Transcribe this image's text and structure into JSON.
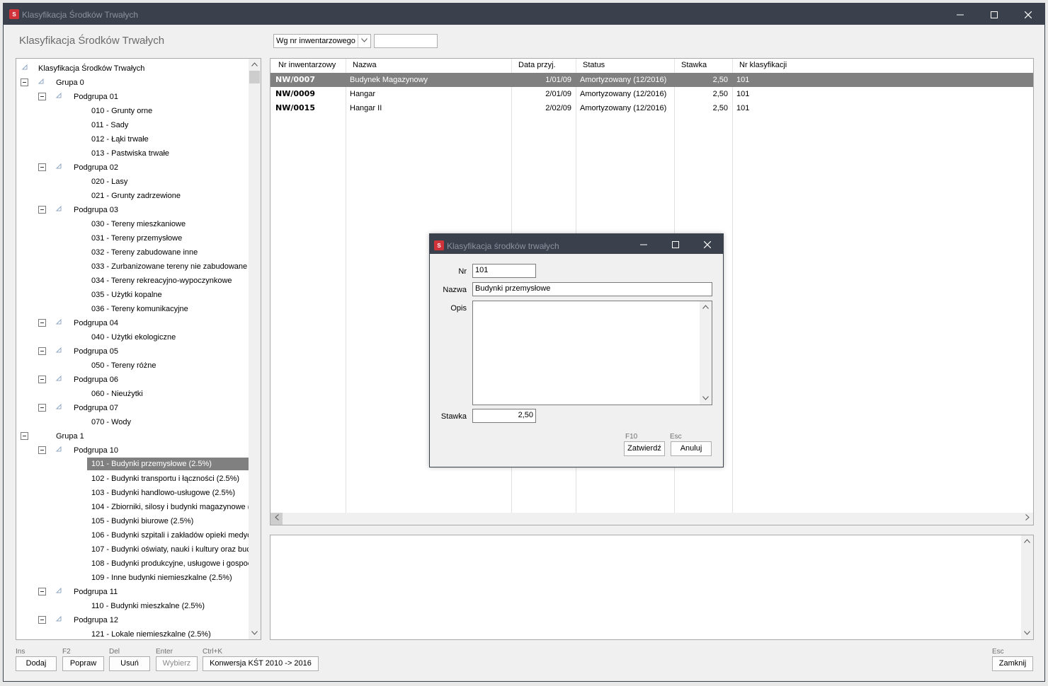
{
  "window": {
    "title": "Klasyfikacja Środków Trwałych",
    "app_icon": "S",
    "minimize": "",
    "maximize": "☐",
    "close": "✕"
  },
  "page": {
    "heading": "Klasyfikacja Środków Trwałych"
  },
  "search": {
    "sort_by": "Wg nr inwentarzowego",
    "query": ""
  },
  "tree": {
    "items": [
      {
        "label": "Klasyfikacja Środków Trwałych",
        "level": 0,
        "expander": false,
        "triangle": true
      },
      {
        "label": "Grupa 0",
        "level": 1,
        "expander": true,
        "triangle": true
      },
      {
        "label": "Podgrupa 01",
        "level": 2,
        "expander": true,
        "triangle": true
      },
      {
        "label": "010 - Grunty orne",
        "level": 3
      },
      {
        "label": "011 - Sady",
        "level": 3
      },
      {
        "label": "012 - Łąki trwałe",
        "level": 3
      },
      {
        "label": "013 - Pastwiska trwałe",
        "level": 3
      },
      {
        "label": "Podgrupa 02",
        "level": 2,
        "expander": true,
        "triangle": true
      },
      {
        "label": "020 - Lasy",
        "level": 3
      },
      {
        "label": "021 - Grunty zadrzewione",
        "level": 3
      },
      {
        "label": "Podgrupa 03",
        "level": 2,
        "expander": true,
        "triangle": true
      },
      {
        "label": "030 - Tereny mieszkaniowe",
        "level": 3
      },
      {
        "label": "031 - Tereny przemysłowe",
        "level": 3
      },
      {
        "label": "032 - Tereny zabudowane inne",
        "level": 3
      },
      {
        "label": "033 - Zurbanizowane tereny nie zabudowane",
        "level": 3
      },
      {
        "label": "034 - Tereny rekreacyjno-wypoczynkowe",
        "level": 3
      },
      {
        "label": "035 - Użytki kopalne",
        "level": 3
      },
      {
        "label": "036 - Tereny komunikacyjne",
        "level": 3
      },
      {
        "label": "Podgrupa 04",
        "level": 2,
        "expander": true,
        "triangle": true
      },
      {
        "label": "040 - Użytki ekologiczne",
        "level": 3
      },
      {
        "label": "Podgrupa 05",
        "level": 2,
        "expander": true,
        "triangle": true
      },
      {
        "label": "050 - Tereny różne",
        "level": 3
      },
      {
        "label": "Podgrupa 06",
        "level": 2,
        "expander": true,
        "triangle": true
      },
      {
        "label": "060 - Nieużytki",
        "level": 3
      },
      {
        "label": "Podgrupa 07",
        "level": 2,
        "expander": true,
        "triangle": true
      },
      {
        "label": "070 - Wody",
        "level": 3
      },
      {
        "label": "Grupa 1",
        "level": 1,
        "expander": true,
        "triangle": false
      },
      {
        "label": "Podgrupa 10",
        "level": 2,
        "expander": true,
        "triangle": true
      },
      {
        "label": "101 - Budynki przemysłowe (2.5%)",
        "level": 3,
        "selected": true
      },
      {
        "label": "102 - Budynki transportu i łączności (2.5%)",
        "level": 3
      },
      {
        "label": "103 - Budynki handlowo-usługowe (2.5%)",
        "level": 3
      },
      {
        "label": "104 - Zbiorniki, silosy i budynki magazynowe (",
        "level": 3
      },
      {
        "label": "105 - Budynki biurowe (2.5%)",
        "level": 3
      },
      {
        "label": "106 - Budynki szpitali i zakładów opieki medyc",
        "level": 3
      },
      {
        "label": "107 - Budynki oświaty, nauki i kultury oraz buc",
        "level": 3
      },
      {
        "label": "108 - Budynki produkcyjne, usługowe i gospoc",
        "level": 3
      },
      {
        "label": "109 - Inne budynki niemieszkalne (2.5%)",
        "level": 3
      },
      {
        "label": "Podgrupa 11",
        "level": 2,
        "expander": true,
        "triangle": true
      },
      {
        "label": "110 - Budynki mieszkalne (2.5%)",
        "level": 3
      },
      {
        "label": "Podgrupa 12",
        "level": 2,
        "expander": true,
        "triangle": true
      },
      {
        "label": "121 - Lokale niemieszkalne (2.5%)",
        "level": 3
      }
    ]
  },
  "grid": {
    "columns": [
      "Nr inwentarzowy",
      "Nazwa",
      "Data przyj.",
      "Status",
      "Stawka",
      "Nr klasyfikacji"
    ],
    "rows": [
      {
        "nr": "NW/0007",
        "nazwa": "Budynek Magazynowy",
        "data": "1/01/09",
        "status": "Amortyzowany (12/2016)",
        "stawka": "2,50",
        "klas": "101",
        "selected": true
      },
      {
        "nr": "NW/0009",
        "nazwa": "Hangar",
        "data": "2/01/09",
        "status": "Amortyzowany (12/2016)",
        "stawka": "2,50",
        "klas": "101"
      },
      {
        "nr": "NW/0015",
        "nazwa": "Hangar II",
        "data": "2/02/09",
        "status": "Amortyzowany (12/2016)",
        "stawka": "2,50",
        "klas": "101"
      }
    ]
  },
  "footer": {
    "buttons": [
      {
        "hotkey": "Ins",
        "label": "Dodaj",
        "enabled": true
      },
      {
        "hotkey": "F2",
        "label": "Popraw",
        "enabled": true
      },
      {
        "hotkey": "Del",
        "label": "Usuń",
        "enabled": true
      },
      {
        "hotkey": "Enter",
        "label": "Wybierz",
        "enabled": false
      },
      {
        "hotkey": "Ctrl+K",
        "label": "Konwersja KŚT 2010 -> 2016",
        "enabled": true
      }
    ],
    "close": {
      "hotkey": "Esc",
      "label": "Zamknij"
    }
  },
  "dialog": {
    "title": "Klasyfikacja środków trwałych",
    "nr_label": "Nr",
    "nr_value": "101",
    "nazwa_label": "Nazwa",
    "nazwa_value": "Budynki przemysłowe",
    "opis_label": "Opis",
    "opis_value": "",
    "stawka_label": "Stawka",
    "stawka_value": "2,50",
    "confirm_hotkey": "F10",
    "confirm_label": "Zatwierdź",
    "cancel_hotkey": "Esc",
    "cancel_label": "Anuluj"
  },
  "colors": {
    "titlebar": "#3a414d",
    "selection": "#808080",
    "app_icon": "#d1333b"
  }
}
